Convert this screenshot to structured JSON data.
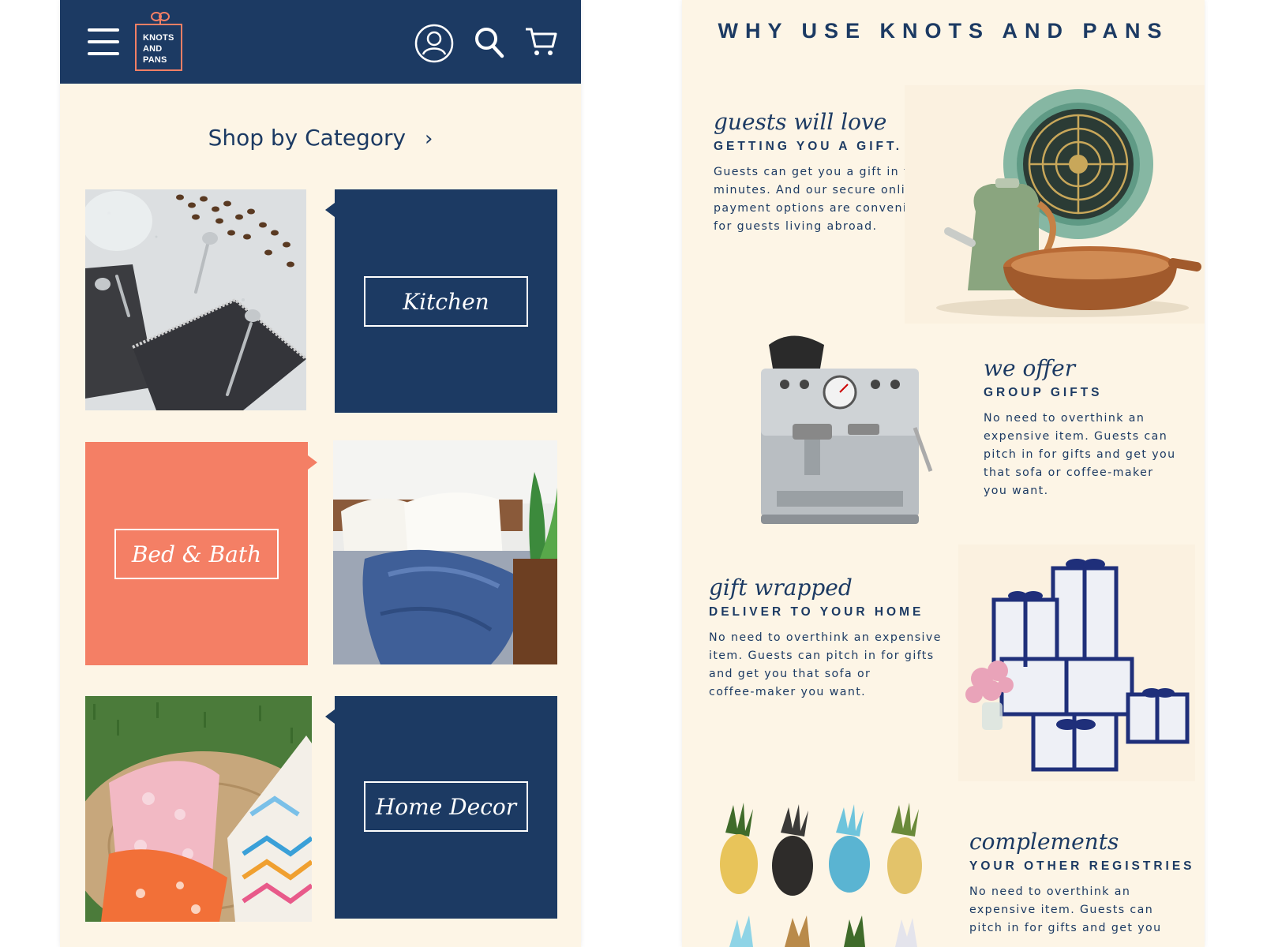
{
  "header": {
    "menu_icon": "hamburger-menu-icon",
    "logo_lines": [
      "KNOTS",
      "AND",
      "PANS"
    ],
    "account_icon": "user-account-icon",
    "search_icon": "search-icon",
    "cart_icon": "shopping-cart-icon"
  },
  "shop": {
    "title": "Shop by Category",
    "chevron": "›"
  },
  "categories": [
    {
      "label": "Kitchen"
    },
    {
      "label": "Bed & Bath"
    },
    {
      "label": "Home Decor"
    }
  ],
  "why": {
    "title": "WHY USE KNOTS AND PANS",
    "features": [
      {
        "script": "guests will love",
        "heading": "GETTING YOU A GIFT.",
        "body": [
          "Guests can get you a gift in t",
          "minutes. And our secure onli",
          "payment options are conveni",
          "for guests living abroad."
        ]
      },
      {
        "script": "we offer",
        "heading": "GROUP GIFTS",
        "body": [
          "No need to overthink an",
          "expensive item. Guests can",
          "pitch in for gifts and get you",
          "that sofa or coffee-maker",
          "you want."
        ]
      },
      {
        "script": "gift wrapped",
        "heading": "DELIVER TO YOUR HOME",
        "body": [
          "No need to overthink an expensive",
          "item. Guests can pitch in for gifts",
          "and get you that sofa or",
          "coffee-maker you want."
        ]
      },
      {
        "script": "complements",
        "heading": "YOUR OTHER REGISTRIES",
        "body": [
          "No need to overthink an",
          "expensive item. Guests can",
          "pitch in for gifts and get you"
        ]
      }
    ]
  },
  "colors": {
    "navy": "#1c3a63",
    "coral": "#f47f65",
    "cream": "#fdf5e6"
  }
}
